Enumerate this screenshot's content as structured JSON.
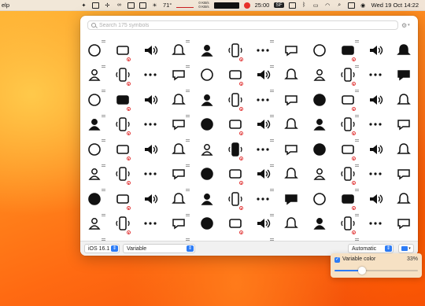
{
  "menubar": {
    "help": "elp",
    "temperature": "71°",
    "net_up": "0 KB/s",
    "net_down": "0 KB/s",
    "timer": "25:00",
    "sel_label": "SF",
    "datetime": "Wed 19 Oct  14:22"
  },
  "search": {
    "placeholder": "Search 175 symbols"
  },
  "footer": {
    "ios_version": "iOS 16.1",
    "rendering": "Variable",
    "weight": "Automatic"
  },
  "variable_color": {
    "label": "Variable color",
    "percent_text": "33%",
    "value": 0.33,
    "checked": true
  },
  "colors": {
    "accent": "#2d7cf6",
    "symbol": "#111111",
    "badge": "#e23a3a"
  },
  "symbols": [
    "creditcard-swipe",
    "externaldrive-wave",
    "drive-wave",
    "list-doc",
    "doc-text-fill",
    "person-wave",
    "person-wave-fill",
    "person-wave-2",
    "person-2-wave",
    "person-2-wave-fill",
    "person-3-wave",
    "person-3-wave-fill",
    "progress-ring-dots",
    "progress-ring-dashes",
    "progress-ring-thin",
    "cursor-rays",
    "dot-radiowaves",
    "dots-sparkle",
    "dots-warning",
    "water-waves",
    "sun-haze",
    "sun-dust",
    "wind-down",
    "square-fill",
    "speaker-wave-1",
    "speaker-fill-wave",
    "speaker-circle-wave",
    "speaker-wave-3",
    "speaker-fill-wave-3",
    "speaker-circle-wave-3",
    "badge-speaker-wave",
    "mic-wave",
    "mic-fill-wave",
    "target-rings",
    "bell-outline-wave",
    "bell-slash",
    "bell-fill",
    "bell-wave",
    "bell-fill-wave",
    "bubble-left-wave",
    "bubble-left-fill",
    "bubble-dots",
    "bubble-dots-fill",
    "message-dots",
    "message-dots-fill",
    "message-exclamation",
    "message-fill-exclamation",
    "message-wave",
    "tv-wave",
    "phone-wave",
    "phone-fill-wave",
    "phone-down-wave",
    "video-wave",
    "video-fill-wave",
    "ellipsis",
    "ellipsis-circle",
    "ellipsis-circle-fill",
    "ellipsis-rect",
    "ellipsis-rect-fill",
    "wand-sparkles",
    "wand-rays",
    "barcode-wave",
    "house-wave",
    "light-beacon",
    "light-beacon-fill",
    "sensor-wave",
    "sensor-fill-wave",
    "sprinkler",
    "shower",
    "lightning-cable",
    "lightning-cable-fill",
    "battery-wave",
    "battery-fill-wave",
    "router",
    "router-fill",
    "key-wave",
    "key-fill-wave",
    "wifi",
    "chip-wave",
    "chip-fill-wave",
    "square-wave",
    "square-fill-wave",
    "joystick",
    "record-knob",
    "circle-wave-left",
    "homepod-wave",
    "appletv-wave",
    "watch-wave",
    "watch-fill-wave",
    "watch-circle-wave",
    "watch-circle-fill",
    "iphone-wave",
    "iphone-fill-wave",
    "ipad-wave",
    "ipad-fill-wave",
    "ipad-circle-wave",
    "laptop-wave",
    "homepod-2",
    "circle-wave",
    "display-wave",
    "appwatch",
    "watch-ring",
    "ellipsis-tail",
    "square-a",
    "square-b",
    "square-c",
    "square-d",
    "square-e"
  ]
}
